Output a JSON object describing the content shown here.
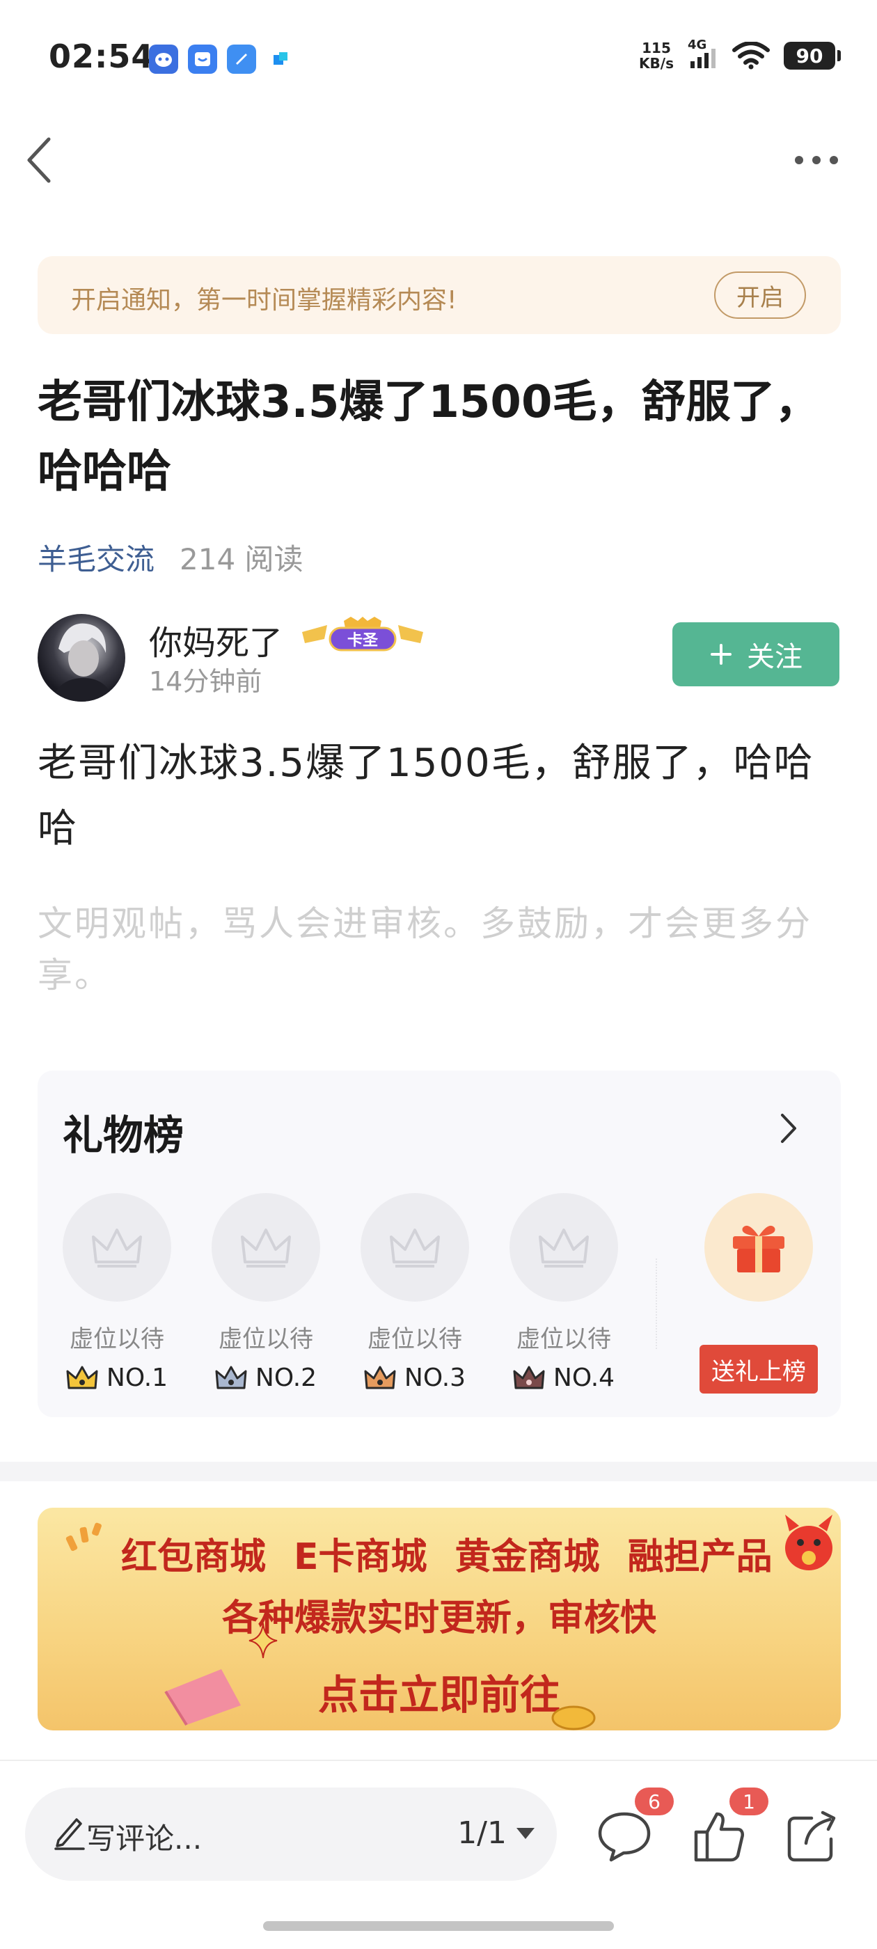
{
  "status_bar": {
    "time": "02:54",
    "net_speed_value": "115",
    "net_speed_unit": "KB/s",
    "signal_label": "4G",
    "battery": "90"
  },
  "notice": {
    "text": "开启通知，第一时间掌握精彩内容!",
    "button": "开启"
  },
  "post": {
    "title": "老哥们冰球3.5爆了1500毛，舒服了，哈哈哈",
    "category": "羊毛交流",
    "reads": "214 阅读",
    "content": "老哥们冰球3.5爆了1500毛，舒服了，哈哈哈",
    "hint": "文明观帖，骂人会进审核。多鼓励，才会更多分享。"
  },
  "author": {
    "name": "你妈死了",
    "badge": "卡圣",
    "time": "14分钟前",
    "follow": "关注"
  },
  "gift_board": {
    "title": "礼物榜",
    "slots": [
      {
        "label": "虚位以待",
        "rank": "NO.1"
      },
      {
        "label": "虚位以待",
        "rank": "NO.2"
      },
      {
        "label": "虚位以待",
        "rank": "NO.3"
      },
      {
        "label": "虚位以待",
        "rank": "NO.4"
      }
    ],
    "send_button": "送礼上榜"
  },
  "promo": {
    "row1": [
      "红包商城",
      "E卡商城",
      "黄金商城",
      "融担产品"
    ],
    "row2": "各种爆款实时更新，审核快",
    "row3": "点击立即前往"
  },
  "bottom_bar": {
    "comment_placeholder": "写评论...",
    "page": "1/1",
    "comment_count": "6",
    "like_count": "1"
  },
  "colors": {
    "accent_green": "#55b693",
    "category_blue": "#3e5e92",
    "badge_red": "#e85a55",
    "gift_red": "#e04a3a"
  }
}
